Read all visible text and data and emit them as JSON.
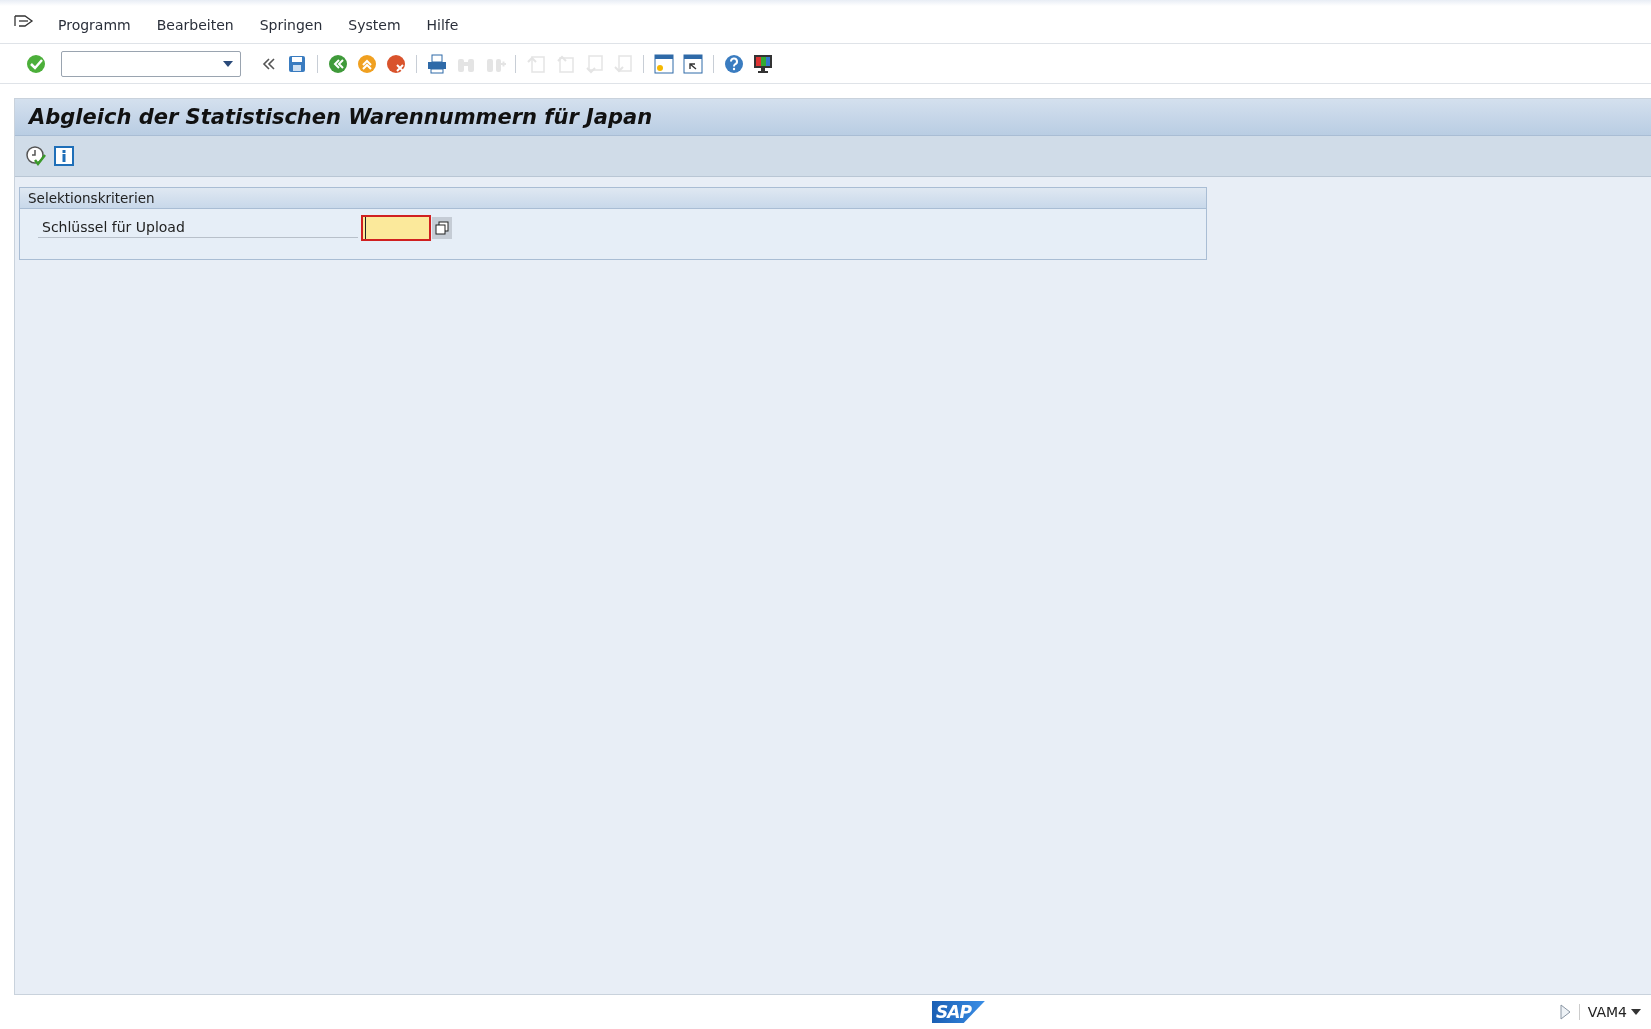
{
  "menu_bar": {
    "items": [
      {
        "label": "Programm"
      },
      {
        "label": "Bearbeiten"
      },
      {
        "label": "Springen"
      },
      {
        "label": "System"
      },
      {
        "label": "Hilfe"
      }
    ]
  },
  "toolbar": {
    "buttons": [
      {
        "kind": "enter",
        "disabled": false
      },
      {
        "kind": "field"
      },
      {
        "kind": "collapse",
        "disabled": false
      },
      {
        "kind": "save",
        "disabled": false
      },
      {
        "kind": "sep"
      },
      {
        "kind": "back",
        "disabled": false
      },
      {
        "kind": "exit",
        "disabled": false
      },
      {
        "kind": "cancel",
        "disabled": false
      },
      {
        "kind": "sep"
      },
      {
        "kind": "print",
        "disabled": false
      },
      {
        "kind": "find",
        "disabled": true
      },
      {
        "kind": "findnext",
        "disabled": true
      },
      {
        "kind": "sep"
      },
      {
        "kind": "first",
        "disabled": true
      },
      {
        "kind": "prev",
        "disabled": true
      },
      {
        "kind": "next",
        "disabled": true
      },
      {
        "kind": "last",
        "disabled": true
      },
      {
        "kind": "sep"
      },
      {
        "kind": "newsession",
        "disabled": false
      },
      {
        "kind": "shortcut",
        "disabled": false
      },
      {
        "kind": "sep"
      },
      {
        "kind": "help",
        "disabled": false
      },
      {
        "kind": "layout",
        "disabled": false
      }
    ]
  },
  "title": "Abgleich der Statistischen Warennummern für Japan",
  "app_toolbar": [
    {
      "kind": "execute"
    },
    {
      "kind": "info"
    }
  ],
  "group": {
    "title": "Selektionskriterien",
    "fields": [
      {
        "label": "Schlüssel für Upload",
        "required": true,
        "focused": true
      }
    ]
  },
  "status_bar": {
    "logo": "SAP",
    "system": "VAM4"
  }
}
